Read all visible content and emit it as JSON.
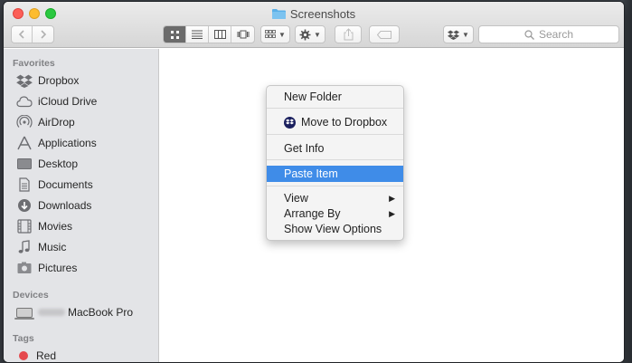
{
  "window": {
    "title": "Screenshots"
  },
  "search": {
    "placeholder": "Search"
  },
  "sidebar": {
    "favorites_title": "Favorites",
    "favorites": [
      {
        "label": "Dropbox",
        "icon": "dropbox-icon"
      },
      {
        "label": "iCloud Drive",
        "icon": "cloud-icon"
      },
      {
        "label": "AirDrop",
        "icon": "airdrop-icon"
      },
      {
        "label": "Applications",
        "icon": "applications-icon"
      },
      {
        "label": "Desktop",
        "icon": "desktop-icon"
      },
      {
        "label": "Documents",
        "icon": "documents-icon"
      },
      {
        "label": "Downloads",
        "icon": "downloads-icon"
      },
      {
        "label": "Movies",
        "icon": "movies-icon"
      },
      {
        "label": "Music",
        "icon": "music-icon"
      },
      {
        "label": "Pictures",
        "icon": "pictures-icon"
      }
    ],
    "devices_title": "Devices",
    "devices": [
      {
        "label": "MacBook Pro",
        "icon": "laptop-icon"
      }
    ],
    "tags_title": "Tags",
    "tags": [
      {
        "label": "Red",
        "color": "#e5484d"
      }
    ]
  },
  "context_menu": {
    "items": [
      {
        "label": "New Folder"
      },
      {
        "label": "Move to Dropbox",
        "icon": "dropbox-icon"
      },
      {
        "label": "Get Info"
      },
      {
        "label": "Paste Item",
        "highlighted": true
      },
      {
        "label": "View",
        "submenu": true
      },
      {
        "label": "Arrange By",
        "submenu": true
      },
      {
        "label": "Show View Options"
      }
    ]
  },
  "colors": {
    "highlight": "#3f8ce8",
    "sidebar_bg": "#e3e4e7",
    "folder": "#5ab0e8",
    "dropbox_blue": "#0061fe"
  }
}
